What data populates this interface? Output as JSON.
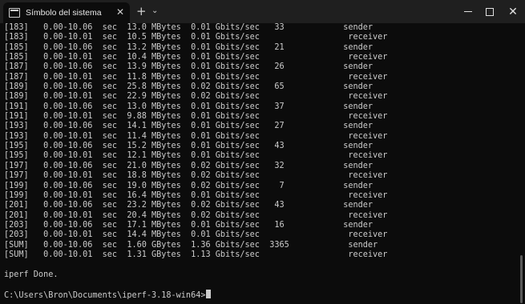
{
  "window": {
    "tab_title": "Símbolo del sistema",
    "tab_close": "✕",
    "new_tab": "+",
    "dropdown": "⌄",
    "min_icon": "minimize-icon",
    "max_icon": "maximize-icon",
    "close_glyph": "✕"
  },
  "console": {
    "lines": [
      "[183]   0.00-10.06  sec  13.0 MBytes  0.01 Gbits/sec   33            sender",
      "[183]   0.00-10.01  sec  10.5 MBytes  0.01 Gbits/sec                  receiver",
      "[185]   0.00-10.06  sec  13.2 MBytes  0.01 Gbits/sec   21            sender",
      "[185]   0.00-10.01  sec  10.4 MBytes  0.01 Gbits/sec                  receiver",
      "[187]   0.00-10.06  sec  13.9 MBytes  0.01 Gbits/sec   26            sender",
      "[187]   0.00-10.01  sec  11.8 MBytes  0.01 Gbits/sec                  receiver",
      "[189]   0.00-10.06  sec  25.8 MBytes  0.02 Gbits/sec   65            sender",
      "[189]   0.00-10.01  sec  22.9 MBytes  0.02 Gbits/sec                  receiver",
      "[191]   0.00-10.06  sec  13.0 MBytes  0.01 Gbits/sec   37            sender",
      "[191]   0.00-10.01  sec  9.88 MBytes  0.01 Gbits/sec                  receiver",
      "[193]   0.00-10.06  sec  14.1 MBytes  0.01 Gbits/sec   27            sender",
      "[193]   0.00-10.01  sec  11.4 MBytes  0.01 Gbits/sec                  receiver",
      "[195]   0.00-10.06  sec  15.2 MBytes  0.01 Gbits/sec   43            sender",
      "[195]   0.00-10.01  sec  12.1 MBytes  0.01 Gbits/sec                  receiver",
      "[197]   0.00-10.06  sec  21.0 MBytes  0.02 Gbits/sec   32            sender",
      "[197]   0.00-10.01  sec  18.8 MBytes  0.02 Gbits/sec                  receiver",
      "[199]   0.00-10.06  sec  19.0 MBytes  0.02 Gbits/sec    7            sender",
      "[199]   0.00-10.01  sec  16.4 MBytes  0.01 Gbits/sec                  receiver",
      "[201]   0.00-10.06  sec  23.2 MBytes  0.02 Gbits/sec   43            sender",
      "[201]   0.00-10.01  sec  20.4 MBytes  0.02 Gbits/sec                  receiver",
      "[203]   0.00-10.06  sec  17.1 MBytes  0.01 Gbits/sec   16            sender",
      "[203]   0.00-10.01  sec  14.4 MBytes  0.01 Gbits/sec                  receiver",
      "[SUM]   0.00-10.06  sec  1.60 GBytes  1.36 Gbits/sec  3365            sender",
      "[SUM]   0.00-10.01  sec  1.31 GBytes  1.13 Gbits/sec                  receiver"
    ],
    "done_text": "iperf Done.",
    "prompt": "C:\\Users\\Bron\\Documents\\iperf-3.18-win64>"
  }
}
